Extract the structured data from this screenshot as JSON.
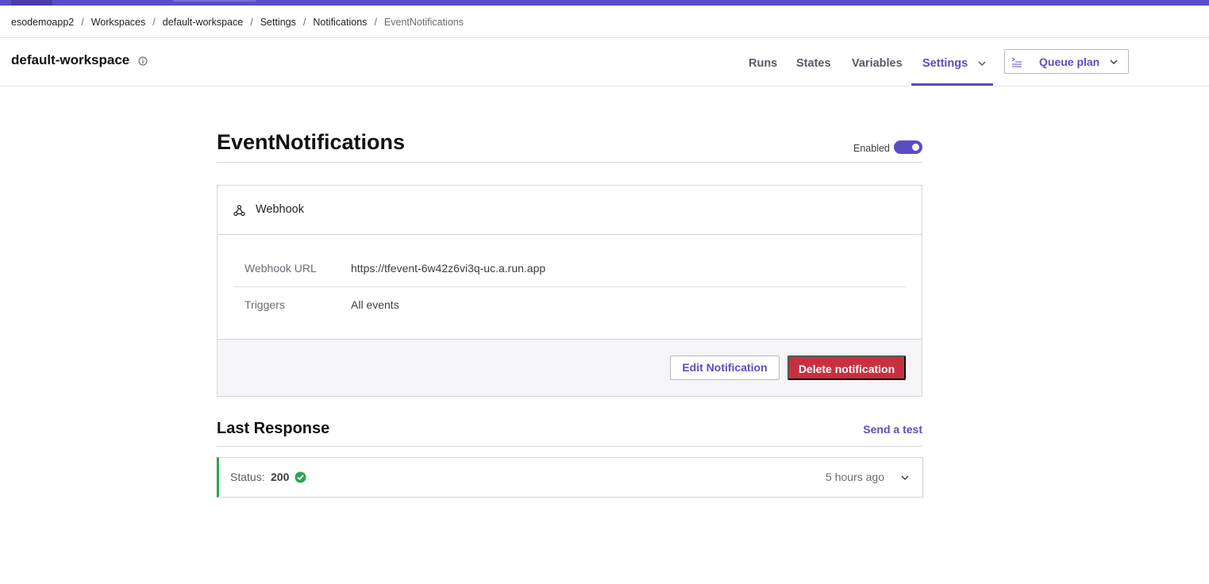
{
  "breadcrumb": {
    "items": [
      "esodemoapp2",
      "Workspaces",
      "default-workspace",
      "Settings",
      "Notifications"
    ],
    "current": "EventNotifications",
    "separator": "/"
  },
  "header": {
    "workspace_title": "default-workspace",
    "info_icon": "info-circle-icon",
    "tabs": [
      {
        "label": "Runs",
        "active": false
      },
      {
        "label": "States",
        "active": false
      },
      {
        "label": "Variables",
        "active": false
      },
      {
        "label": "Settings",
        "active": true
      }
    ],
    "queue_plan_label": "Queue plan",
    "queue_plan_icon": "terminal-lines-icon"
  },
  "notification": {
    "title": "EventNotifications",
    "enabled_label": "Enabled",
    "enabled": true,
    "type_label": "Webhook",
    "type_icon": "webhook-icon",
    "fields": [
      {
        "key": "Webhook URL",
        "value": "https://tfevent-6w42z6vi3q-uc.a.run.app"
      },
      {
        "key": "Triggers",
        "value": "All events"
      }
    ],
    "edit_label": "Edit Notification",
    "delete_label": "Delete notification"
  },
  "last_response": {
    "title": "Last Response",
    "send_test_label": "Send a test",
    "status_label": "Status:",
    "status_code": "200",
    "status_icon": "check-circle-icon",
    "time": "5 hours ago"
  },
  "colors": {
    "accent": "#5b4cc6",
    "danger": "#c8303f",
    "success": "#2ea44f"
  }
}
